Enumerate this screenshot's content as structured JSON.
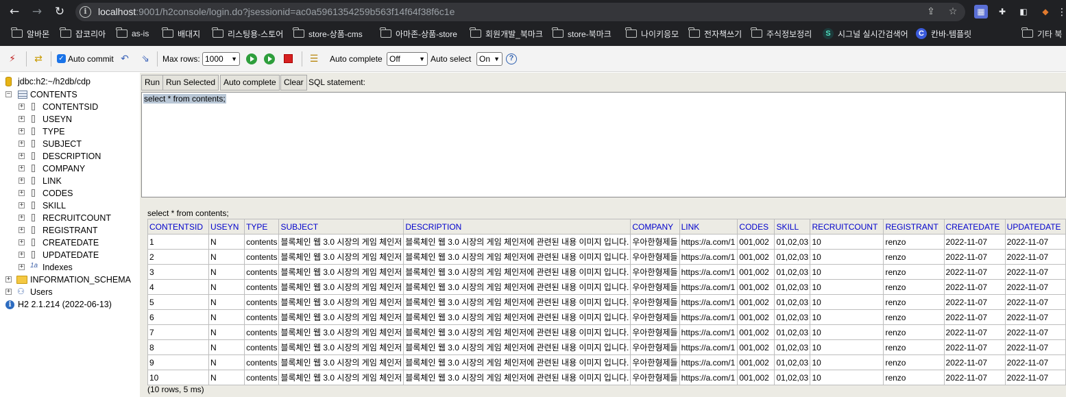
{
  "browser": {
    "url_host": "localhost",
    "url_rest": ":9001/h2console/login.do?jsessionid=ac0a5961354259b563f14f64f38f6c1e",
    "bookmarks": [
      "알바몬",
      "잡코리아",
      "as-is",
      "배대지",
      "리스팅용-스토어",
      "store-상품-cms",
      "아마존-상품-store",
      "회원개발_북마크",
      "store-북마크",
      "나이키응모",
      "전자책쓰기",
      "주식정보정리",
      "시그널 실시간검색어",
      "칸바-템플릿"
    ],
    "other_bookmarks": "기타 북"
  },
  "toolbar": {
    "auto_commit_label": "Auto commit",
    "max_rows_label": "Max rows:",
    "max_rows_value": "1000",
    "auto_complete_label": "Auto complete",
    "auto_complete_value": "Off",
    "auto_select_label": "Auto select",
    "auto_select_value": "On"
  },
  "tree": {
    "connection": "jdbc:h2:~/h2db/cdp",
    "table": "CONTENTS",
    "columns": [
      "CONTENTSID",
      "USEYN",
      "TYPE",
      "SUBJECT",
      "DESCRIPTION",
      "COMPANY",
      "LINK",
      "CODES",
      "SKILL",
      "RECRUITCOUNT",
      "REGISTRANT",
      "CREATEDATE",
      "UPDATEDATE"
    ],
    "indexes": "Indexes",
    "information_schema": "INFORMATION_SCHEMA",
    "users": "Users",
    "version": "H2 2.1.214 (2022-06-13)"
  },
  "query": {
    "run": "Run",
    "run_selected": "Run Selected",
    "auto_complete": "Auto complete",
    "clear": "Clear",
    "sql_label": "SQL statement:",
    "sql_text": "select * from contents;"
  },
  "result": {
    "echo": "select * from contents;",
    "headers": [
      "CONTENTSID",
      "USEYN",
      "TYPE",
      "SUBJECT",
      "DESCRIPTION",
      "COMPANY",
      "LINK",
      "CODES",
      "SKILL",
      "RECRUITCOUNT",
      "REGISTRANT",
      "CREATEDATE",
      "UPDATEDATE"
    ],
    "rows": [
      [
        "1",
        "N",
        "contents",
        "블록체인 웹 3.0 시장의 게임 체인저",
        "블록체인 웹 3.0 시장의 게임 체인저에 관련된 내용 이미지 입니다.",
        "우아한형제들",
        "https://a.com/1",
        "001,002",
        "01,02,03",
        "10",
        "renzo",
        "2022-11-07",
        "2022-11-07"
      ],
      [
        "2",
        "N",
        "contents",
        "블록체인 웹 3.0 시장의 게임 체인저",
        "블록체인 웹 3.0 시장의 게임 체인저에 관련된 내용 이미지 입니다.",
        "우아한형제들",
        "https://a.com/1",
        "001,002",
        "01,02,03",
        "10",
        "renzo",
        "2022-11-07",
        "2022-11-07"
      ],
      [
        "3",
        "N",
        "contents",
        "블록체인 웹 3.0 시장의 게임 체인저",
        "블록체인 웹 3.0 시장의 게임 체인저에 관련된 내용 이미지 입니다.",
        "우아한형제들",
        "https://a.com/1",
        "001,002",
        "01,02,03",
        "10",
        "renzo",
        "2022-11-07",
        "2022-11-07"
      ],
      [
        "4",
        "N",
        "contents",
        "블록체인 웹 3.0 시장의 게임 체인저",
        "블록체인 웹 3.0 시장의 게임 체인저에 관련된 내용 이미지 입니다.",
        "우아한형제들",
        "https://a.com/1",
        "001,002",
        "01,02,03",
        "10",
        "renzo",
        "2022-11-07",
        "2022-11-07"
      ],
      [
        "5",
        "N",
        "contents",
        "블록체인 웹 3.0 시장의 게임 체인저",
        "블록체인 웹 3.0 시장의 게임 체인저에 관련된 내용 이미지 입니다.",
        "우아한형제들",
        "https://a.com/1",
        "001,002",
        "01,02,03",
        "10",
        "renzo",
        "2022-11-07",
        "2022-11-07"
      ],
      [
        "6",
        "N",
        "contents",
        "블록체인 웹 3.0 시장의 게임 체인저",
        "블록체인 웹 3.0 시장의 게임 체인저에 관련된 내용 이미지 입니다.",
        "우아한형제들",
        "https://a.com/1",
        "001,002",
        "01,02,03",
        "10",
        "renzo",
        "2022-11-07",
        "2022-11-07"
      ],
      [
        "7",
        "N",
        "contents",
        "블록체인 웹 3.0 시장의 게임 체인저",
        "블록체인 웹 3.0 시장의 게임 체인저에 관련된 내용 이미지 입니다.",
        "우아한형제들",
        "https://a.com/1",
        "001,002",
        "01,02,03",
        "10",
        "renzo",
        "2022-11-07",
        "2022-11-07"
      ],
      [
        "8",
        "N",
        "contents",
        "블록체인 웹 3.0 시장의 게임 체인저",
        "블록체인 웹 3.0 시장의 게임 체인저에 관련된 내용 이미지 입니다.",
        "우아한형제들",
        "https://a.com/1",
        "001,002",
        "01,02,03",
        "10",
        "renzo",
        "2022-11-07",
        "2022-11-07"
      ],
      [
        "9",
        "N",
        "contents",
        "블록체인 웹 3.0 시장의 게임 체인저",
        "블록체인 웹 3.0 시장의 게임 체인저에 관련된 내용 이미지 입니다.",
        "우아한형제들",
        "https://a.com/1",
        "001,002",
        "01,02,03",
        "10",
        "renzo",
        "2022-11-07",
        "2022-11-07"
      ],
      [
        "10",
        "N",
        "contents",
        "블록체인 웹 3.0 시장의 게임 체인저",
        "블록체인 웹 3.0 시장의 게임 체인저에 관련된 내용 이미지 입니다.",
        "우아한형제들",
        "https://a.com/1",
        "001,002",
        "01,02,03",
        "10",
        "renzo",
        "2022-11-07",
        "2022-11-07"
      ]
    ],
    "footer": "(10 rows, 5 ms)"
  }
}
